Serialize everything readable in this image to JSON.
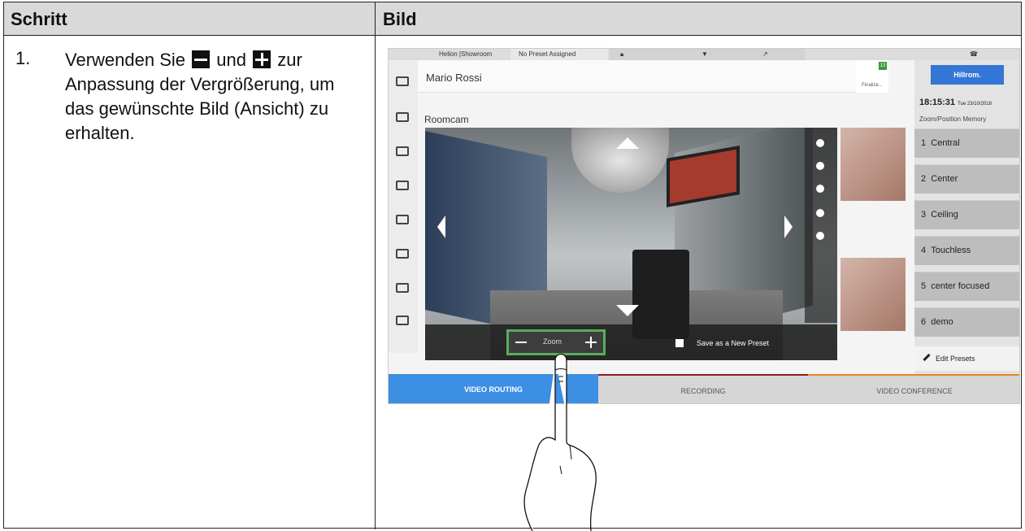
{
  "table": {
    "header_step": "Schritt",
    "header_image": "Bild",
    "step_number": "1.",
    "text_before": "Verwenden Sie",
    "text_and": "und",
    "text_after": "zur Anpassung der Vergrößerung, um das gewünschte Bild (Ansicht) zu erhalten."
  },
  "screen": {
    "topbar": {
      "location": "Helion |Showroom",
      "preset": "No Preset Assigned"
    },
    "patient_name": "Mario Rossi",
    "finalize_label": "Finalize...",
    "notification_count": "13",
    "camera_title": "Roomcam",
    "zoom_label": "Zoom",
    "save_preset_label": "Save as a New Preset",
    "brand": "Hillrom.",
    "time": "18:15:31",
    "date": "Tue 23/10/2018",
    "memory_title": "Zoom/Position Memory",
    "presets": [
      {
        "num": "1",
        "name": "Central"
      },
      {
        "num": "2",
        "name": "Center"
      },
      {
        "num": "3",
        "name": "Ceiling"
      },
      {
        "num": "4",
        "name": "Touchless"
      },
      {
        "num": "5",
        "name": "center focused"
      },
      {
        "num": "6",
        "name": "demo"
      }
    ],
    "edit_presets_label": "Edit Presets",
    "nav": {
      "video_routing": "VIDEO ROUTING",
      "recording": "RECORDING",
      "video_conference": "VIDEO CONFERENCE"
    }
  },
  "colors": {
    "zoom_highlight": "#5aad5a",
    "active_tab": "#3d8fe3",
    "brand_blue": "#3376d6"
  }
}
